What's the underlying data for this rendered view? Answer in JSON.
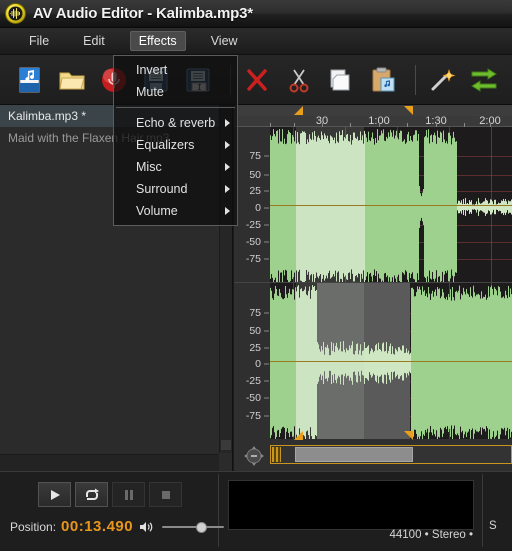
{
  "window": {
    "title": "AV Audio Editor - Kalimba.mp3*",
    "app_icon": "waveform-circle-icon"
  },
  "menubar": {
    "items": [
      {
        "label": "File",
        "active": false
      },
      {
        "label": "Edit",
        "active": false
      },
      {
        "label": "Effects",
        "active": true
      },
      {
        "label": "View",
        "active": false
      }
    ]
  },
  "toolbar": {
    "buttons": [
      {
        "name": "new-file-button",
        "icon": "new-audio-file-icon"
      },
      {
        "name": "open-file-button",
        "icon": "open-folder-icon"
      },
      {
        "name": "record-button",
        "icon": "record-microphone-icon"
      },
      {
        "name": "save-button",
        "icon": "save-disk-icon"
      },
      {
        "name": "save-as-button",
        "icon": "save-as-disk-icon"
      },
      {
        "name": "delete-button",
        "icon": "red-x-delete-icon"
      },
      {
        "name": "cut-button",
        "icon": "scissors-cut-icon"
      },
      {
        "name": "copy-button",
        "icon": "copy-pages-icon"
      },
      {
        "name": "paste-button",
        "icon": "clipboard-paste-icon"
      },
      {
        "name": "effects-wand-button",
        "icon": "magic-wand-icon"
      },
      {
        "name": "undo-button",
        "icon": "green-arrow-right-icon"
      },
      {
        "name": "redo-button",
        "icon": "green-arrow-left-icon"
      }
    ]
  },
  "effects_menu": {
    "open": true,
    "items": [
      {
        "label": "Invert",
        "submenu": false
      },
      {
        "label": "Mute",
        "submenu": false
      },
      {
        "separator": true
      },
      {
        "label": "Echo & reverb",
        "submenu": true
      },
      {
        "label": "Equalizers",
        "submenu": true
      },
      {
        "label": "Misc",
        "submenu": true
      },
      {
        "label": "Surround",
        "submenu": true
      },
      {
        "label": "Volume",
        "submenu": true
      }
    ]
  },
  "sidebar": {
    "files": [
      {
        "label": "Kalimba.mp3 *",
        "selected": true
      },
      {
        "label": "Maid with the Flaxen Hair.mp3",
        "selected": false
      }
    ]
  },
  "editor": {
    "ruler": {
      "labels": [
        "30",
        "1:00",
        "1:30",
        "2:00"
      ],
      "positions_pct": [
        31.5,
        56.0,
        79.5,
        99.0
      ]
    },
    "markers": [
      {
        "name": "selection-start-marker",
        "pos_pct": 22.0,
        "dir": "left"
      },
      {
        "name": "selection-end-marker",
        "pos_pct": 76.0,
        "dir": "right"
      }
    ],
    "scale_labels": [
      "75",
      "50",
      "25",
      "0",
      "-25",
      "-50",
      "-75"
    ],
    "channels": [
      {
        "name": "channel-left",
        "selection_start_pct": 22.0,
        "selection_end_pct": 76.0
      },
      {
        "name": "channel-right",
        "selection_start_pct": 22.0,
        "selection_end_pct": 76.0
      }
    ],
    "scrollbar": {
      "thumb_start_pct": 18.0,
      "thumb_end_pct": 63.0
    }
  },
  "player": {
    "transport": [
      {
        "name": "play-button",
        "icon": "play-icon",
        "enabled": true
      },
      {
        "name": "loop-button",
        "icon": "loop-repeat-icon",
        "enabled": true
      },
      {
        "name": "pause-button",
        "icon": "pause-icon",
        "enabled": false
      },
      {
        "name": "stop-button",
        "icon": "stop-icon",
        "enabled": false
      }
    ],
    "position_label": "Position:",
    "position_value": "00:13.490",
    "volume_icon": "speaker-volume-icon",
    "volume_pct": 58,
    "format_text": "44100 • Stereo •",
    "edge_text": "S"
  },
  "colors": {
    "accent_orange": "#e8961c",
    "marker_yellow": "#e8a01c",
    "waveform_green": "#9fd18e",
    "waveform_green_light": "#cfe8c3",
    "selection_gray": "#5a5a5a",
    "window_bg": "#1e1e1e",
    "titlebar_bg": "#2e2e2e"
  }
}
